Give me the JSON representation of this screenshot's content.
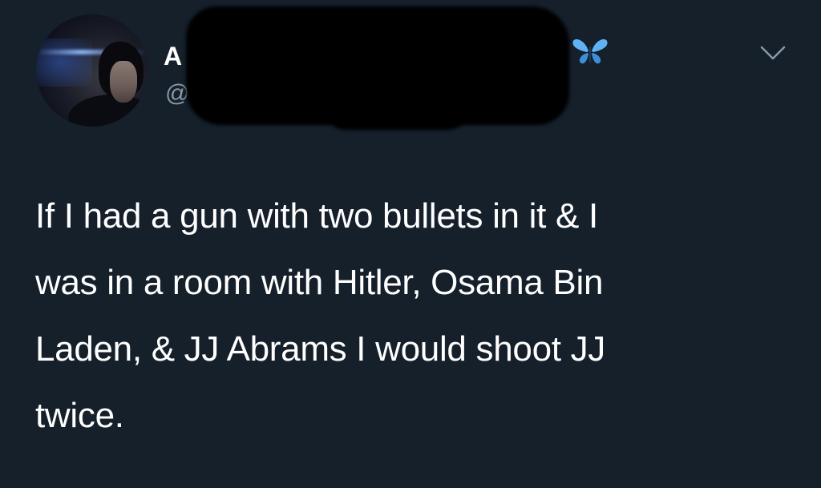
{
  "header": {
    "display_name_visible_fragment": "A",
    "handle_visible_fragment": "@L",
    "verified_emoji_icon": "butterfly-icon",
    "menu_icon": "chevron-down-icon"
  },
  "tweet": {
    "lines": [
      "If I had a gun with two bullets in it & I",
      "was in a room with Hitler, Osama Bin",
      "Laden, & JJ Abrams I would shoot JJ",
      "twice."
    ]
  },
  "colors": {
    "background": "#15202b",
    "text_primary": "#ffffff",
    "text_secondary": "#8899a6",
    "butterfly": "#5fb3f5"
  }
}
